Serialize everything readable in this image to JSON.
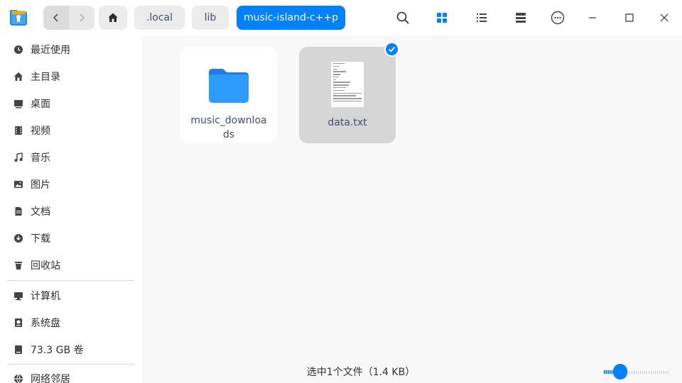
{
  "titlebar": {
    "breadcrumbs": [
      ".local",
      "lib",
      "music-island-c++p"
    ],
    "icons": [
      "app-logo-icon",
      "back-icon",
      "forward-icon",
      "home-icon",
      "search-icon",
      "icon-view-icon",
      "list-view-icon",
      "tree-view-icon",
      "more-icon",
      "minimize-icon",
      "maximize-icon",
      "close-icon"
    ]
  },
  "sidebar": {
    "items": [
      {
        "label": "最近使用",
        "icon": "clock-icon"
      },
      {
        "label": "主目录",
        "icon": "home-icon"
      },
      {
        "label": "桌面",
        "icon": "desktop-icon"
      },
      {
        "label": "视频",
        "icon": "video-icon"
      },
      {
        "label": "音乐",
        "icon": "music-icon"
      },
      {
        "label": "图片",
        "icon": "picture-icon"
      },
      {
        "label": "文档",
        "icon": "document-icon"
      },
      {
        "label": "下载",
        "icon": "download-icon"
      },
      {
        "label": "回收站",
        "icon": "trash-icon"
      }
    ],
    "devices": [
      {
        "label": "计算机",
        "icon": "computer-icon"
      },
      {
        "label": "系统盘",
        "icon": "system-disk-icon"
      },
      {
        "label": "73.3 GB 卷",
        "icon": "volume-icon"
      }
    ],
    "network": [
      {
        "label": "网络邻居",
        "icon": "network-icon"
      }
    ]
  },
  "main": {
    "files": [
      {
        "name": "music_downloads",
        "type": "folder",
        "selected": false
      },
      {
        "name": "data.txt",
        "type": "text",
        "selected": true
      }
    ],
    "status_text": "选中1个文件（1.4 KB）",
    "zoom_level": 0.25
  },
  "colors": {
    "accent": "#0081ff",
    "folder": "#2e9bff",
    "sidebar_bg": "#ffffff",
    "main_bg": "#f8f8f8"
  }
}
